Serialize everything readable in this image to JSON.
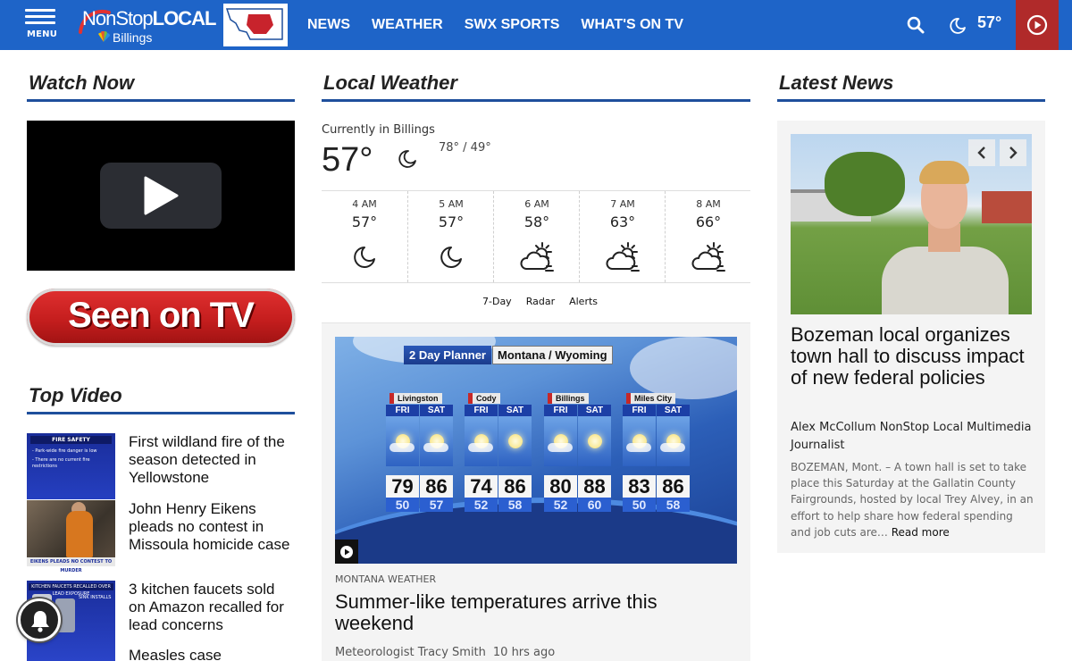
{
  "header": {
    "menu_label": "MENU",
    "logo_text_1": "NonStop",
    "logo_text_2": "LOCAL",
    "logo_city": "Billings",
    "nav": [
      "NEWS",
      "WEATHER",
      "SWX SPORTS",
      "WHAT'S ON TV"
    ],
    "current_temp": "57°",
    "colors": {
      "bar": "#1e64c8",
      "live": "#b02a2a"
    }
  },
  "watch_now": {
    "heading": "Watch Now",
    "seen_on_tv": "Seen on TV"
  },
  "top_video": {
    "heading": "Top Video",
    "items": [
      {
        "title": "First wildland fire of the season detected in Yellowstone",
        "thumb_lines": [
          "FIRE SAFETY",
          "- Park-wide fire danger is low",
          "- There are no current fire restrictions"
        ]
      },
      {
        "title": "John Henry Eikens pleads no contest in Missoula homicide case",
        "thumb_lines": [
          "EIKENS PLEADS NO CONTEST TO MURDER"
        ]
      },
      {
        "title": "3 kitchen faucets sold on Amazon recalled for lead concerns",
        "thumb_lines": [
          "KITCHEN FAUCETS RECALLED OVER LEAD EXPOSURE",
          "SINK INSTALLS"
        ]
      },
      {
        "title": "Measles case",
        "thumb_lines": []
      }
    ]
  },
  "weather": {
    "heading": "Local Weather",
    "current_label": "Currently in Billings",
    "current_temp": "57°",
    "hi_lo": "78° / 49°",
    "hourly": [
      {
        "time": "4 AM",
        "temp": "57°",
        "icon": "moon-icon"
      },
      {
        "time": "5 AM",
        "temp": "57°",
        "icon": "moon-icon"
      },
      {
        "time": "6 AM",
        "temp": "58°",
        "icon": "partly-cloudy-icon"
      },
      {
        "time": "7 AM",
        "temp": "63°",
        "icon": "partly-cloudy-icon"
      },
      {
        "time": "8 AM",
        "temp": "66°",
        "icon": "partly-cloudy-icon"
      }
    ],
    "links": [
      "7-Day",
      "Radar",
      "Alerts"
    ]
  },
  "planner": {
    "title": "2 Day Planner",
    "region": "Montana / Wyoming",
    "cities": [
      {
        "name": "Livingston",
        "days": [
          {
            "day": "FRI",
            "hi": "79",
            "lo": "50"
          },
          {
            "day": "SAT",
            "hi": "86",
            "lo": "57"
          }
        ]
      },
      {
        "name": "Cody",
        "days": [
          {
            "day": "FRI",
            "hi": "74",
            "lo": "52"
          },
          {
            "day": "SAT",
            "hi": "86",
            "lo": "58"
          }
        ]
      },
      {
        "name": "Billings",
        "days": [
          {
            "day": "FRI",
            "hi": "80",
            "lo": "52"
          },
          {
            "day": "SAT",
            "hi": "88",
            "lo": "60"
          }
        ]
      },
      {
        "name": "Miles City",
        "days": [
          {
            "day": "FRI",
            "hi": "83",
            "lo": "50"
          },
          {
            "day": "SAT",
            "hi": "86",
            "lo": "58"
          }
        ]
      }
    ]
  },
  "weather_story": {
    "kicker": "MONTANA WEATHER",
    "headline": "Summer-like temperatures arrive this weekend",
    "author": "Meteorologist Tracy Smith",
    "time_ago": "10 hrs ago"
  },
  "latest_news": {
    "heading": "Latest News",
    "headline": "Bozeman local organizes town hall to discuss impact of new federal policies",
    "author": "Alex McCollum NonStop Local Multimedia Journalist",
    "excerpt": "BOZEMAN, Mont. – A town hall is set to take place this Saturday at the Gallatin County Fairgrounds, hosted by local Trey Alvey, in an effort to help share how federal spending and job cuts are…",
    "read_more": "Read more"
  }
}
